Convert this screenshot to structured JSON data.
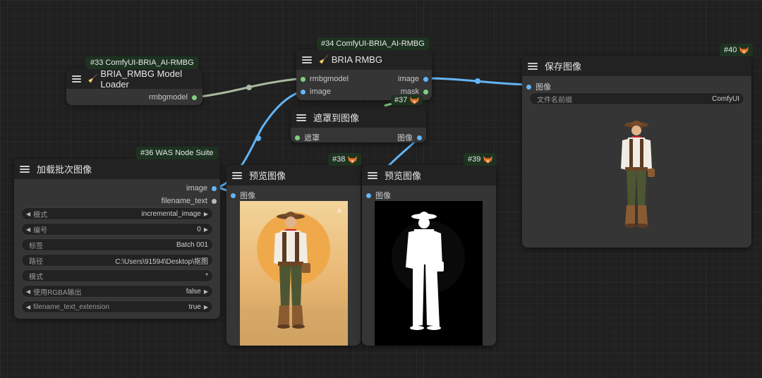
{
  "nodes": {
    "model_loader": {
      "badge": "#33 ComfyUI-BRIA_AI-RMBG",
      "title": "BRIA_RMBG Model Loader",
      "output": "rmbgmodel"
    },
    "bria_rmbg": {
      "badge": "#34 ComfyUI-BRIA_AI-RMBG",
      "title": "BRIA RMBG",
      "inputs": [
        "rmbgmodel",
        "image"
      ],
      "outputs": [
        "image",
        "mask"
      ]
    },
    "mask_to_image": {
      "badge": "#37",
      "title": "遮罩到图像",
      "input": "遮罩",
      "output": "图像"
    },
    "load_batch": {
      "badge": "#36 WAS Node Suite",
      "title": "加载批次图像",
      "outputs": [
        "image",
        "filename_text"
      ],
      "widgets": [
        {
          "label": "模式",
          "value": "incremental_image",
          "arrows": true
        },
        {
          "label": "编号",
          "value": "0",
          "arrows": true
        },
        {
          "label": "标签",
          "value": "Batch 001",
          "arrows": false
        },
        {
          "label": "路径",
          "value": "C:\\Users\\91594\\Desktop\\抠图",
          "arrows": false
        },
        {
          "label": "模式",
          "value": "*",
          "arrows": false
        },
        {
          "label": "使用RGBA输出",
          "value": "false",
          "arrows": true
        },
        {
          "label": "filename_text_extension",
          "value": "true",
          "arrows": true
        }
      ]
    },
    "preview_38": {
      "badge": "#38",
      "title": "预览图像",
      "input": "图像"
    },
    "preview_39": {
      "badge": "#39",
      "title": "预览图像",
      "input": "图像"
    },
    "save_image": {
      "badge": "#40",
      "title": "保存图像",
      "input": "图像",
      "widget_label": "文件名前缀",
      "widget_value": "ComfyUI"
    }
  },
  "colors": {
    "image_wire": "#64b5f6",
    "model_wire": "#a8b9a0",
    "badge_bg": "#1d3320",
    "node_bg": "#353535"
  },
  "icons": [
    "menu-icon",
    "broom-icon",
    "fox-icon",
    "arrow-left-icon",
    "arrow-right-icon"
  ]
}
